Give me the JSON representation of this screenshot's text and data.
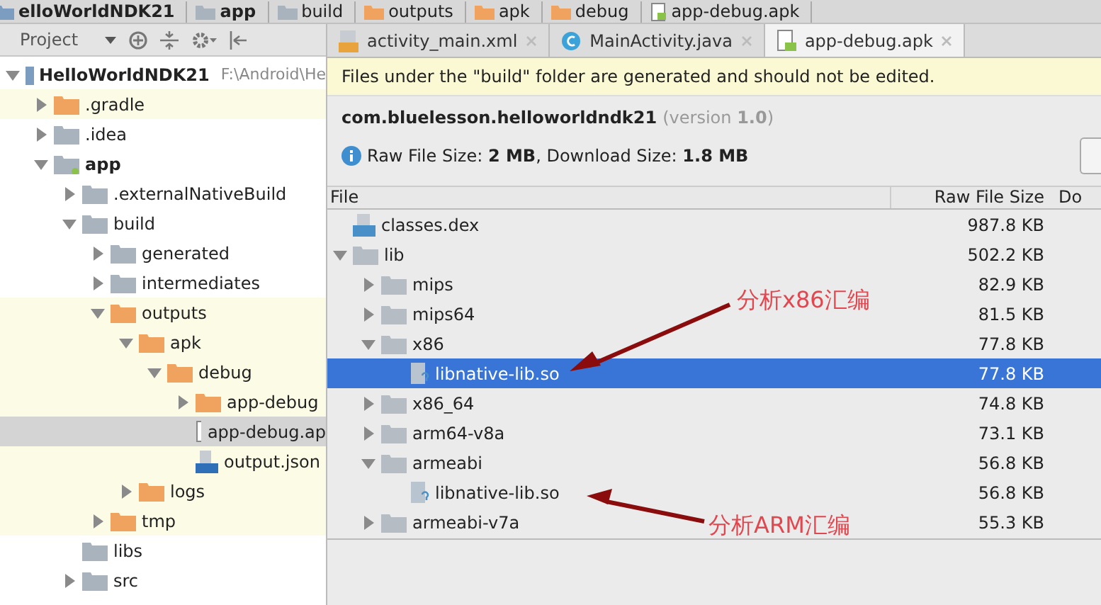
{
  "breadcrumb": [
    {
      "label": "elloWorldNDK21",
      "kind": "project"
    },
    {
      "label": "app",
      "kind": "module"
    },
    {
      "label": "build",
      "kind": "folder"
    },
    {
      "label": "outputs",
      "kind": "folder-orange"
    },
    {
      "label": "apk",
      "kind": "folder-orange"
    },
    {
      "label": "debug",
      "kind": "folder-orange"
    },
    {
      "label": "app-debug.apk",
      "kind": "apk"
    }
  ],
  "project_panel": {
    "title": "Project",
    "tree": [
      {
        "label": "HelloWorldNDK21",
        "path": "F:\\Android\\He",
        "kind": "project",
        "expanded": true,
        "selected": false,
        "highlighted": false,
        "children": [
          {
            "label": ".gradle",
            "kind": "folder-orange",
            "expanded": false,
            "selected": false,
            "highlighted": true
          },
          {
            "label": ".idea",
            "kind": "folder",
            "expanded": false,
            "selected": false,
            "highlighted": false
          },
          {
            "label": "app",
            "kind": "module",
            "expanded": true,
            "selected": false,
            "highlighted": false,
            "children": [
              {
                "label": ".externalNativeBuild",
                "kind": "folder",
                "expanded": false,
                "selected": false,
                "highlighted": false
              },
              {
                "label": "build",
                "kind": "folder",
                "expanded": true,
                "selected": false,
                "highlighted": false,
                "children": [
                  {
                    "label": "generated",
                    "kind": "folder",
                    "expanded": false,
                    "selected": false,
                    "highlighted": false
                  },
                  {
                    "label": "intermediates",
                    "kind": "folder",
                    "expanded": false,
                    "selected": false,
                    "highlighted": false
                  },
                  {
                    "label": "outputs",
                    "kind": "folder-orange",
                    "expanded": true,
                    "selected": false,
                    "highlighted": true,
                    "children": [
                      {
                        "label": "apk",
                        "kind": "folder-orange",
                        "expanded": true,
                        "selected": false,
                        "highlighted": true,
                        "children": [
                          {
                            "label": "debug",
                            "kind": "folder-orange",
                            "expanded": true,
                            "selected": false,
                            "highlighted": true,
                            "children": [
                              {
                                "label": "app-debug",
                                "kind": "folder-orange",
                                "expanded": false,
                                "selected": false,
                                "highlighted": true
                              },
                              {
                                "label": "app-debug.ap",
                                "kind": "apk",
                                "selected": true,
                                "highlighted": true
                              },
                              {
                                "label": "output.json",
                                "kind": "json",
                                "selected": false,
                                "highlighted": true
                              }
                            ]
                          }
                        ]
                      },
                      {
                        "label": "logs",
                        "kind": "folder-orange",
                        "expanded": false,
                        "selected": false,
                        "highlighted": true
                      }
                    ]
                  },
                  {
                    "label": "tmp",
                    "kind": "folder-orange",
                    "expanded": false,
                    "selected": false,
                    "highlighted": true
                  }
                ]
              },
              {
                "label": "libs",
                "kind": "folder",
                "selected": false,
                "highlighted": false
              },
              {
                "label": "src",
                "kind": "folder",
                "expanded": false,
                "selected": false,
                "highlighted": false
              }
            ]
          }
        ]
      }
    ]
  },
  "tabs": [
    {
      "label": "activity_main.xml",
      "kind": "xml",
      "selected": false
    },
    {
      "label": "MainActivity.java",
      "kind": "class",
      "selected": false
    },
    {
      "label": "app-debug.apk",
      "kind": "apk",
      "selected": true
    }
  ],
  "notice": "Files under the \"build\" folder are generated and should not be edited.",
  "apk": {
    "package": "com.bluelesson.helloworldndk21",
    "version": "(version **1.0**)",
    "sizes": "Raw File Size: **2 MB**, Download Size: **1.8 MB**"
  },
  "table": {
    "columns": [
      "File",
      "Raw File Size",
      "Do"
    ],
    "rows": [
      {
        "name": "classes.dex",
        "kind": "dex",
        "size": "987.8 KB",
        "selected": false
      },
      {
        "name": "lib",
        "kind": "folder",
        "size": "502.2 KB",
        "expanded": true,
        "selected": false,
        "children": [
          {
            "name": "mips",
            "kind": "folder",
            "size": "82.9 KB",
            "expanded": false,
            "selected": false
          },
          {
            "name": "mips64",
            "kind": "folder",
            "size": "81.5 KB",
            "expanded": false,
            "selected": false
          },
          {
            "name": "x86",
            "kind": "folder",
            "size": "77.8 KB",
            "expanded": true,
            "selected": false,
            "children": [
              {
                "name": "libnative-lib.so",
                "kind": "so",
                "size": "77.8 KB",
                "selected": true
              }
            ]
          },
          {
            "name": "x86_64",
            "kind": "folder",
            "size": "74.8 KB",
            "expanded": false,
            "selected": false
          },
          {
            "name": "arm64-v8a",
            "kind": "folder",
            "size": "73.1 KB",
            "expanded": false,
            "selected": false
          },
          {
            "name": "armeabi",
            "kind": "folder",
            "size": "56.8 KB",
            "expanded": true,
            "selected": false,
            "children": [
              {
                "name": "libnative-lib.so",
                "kind": "so",
                "size": "56.8 KB",
                "selected": false
              }
            ]
          },
          {
            "name": "armeabi-v7a",
            "kind": "folder",
            "size": "55.3 KB",
            "expanded": false,
            "selected": false
          }
        ]
      }
    ]
  },
  "annotations": [
    {
      "text": "分析x86汇编"
    },
    {
      "text": "分析ARM汇编"
    }
  ]
}
